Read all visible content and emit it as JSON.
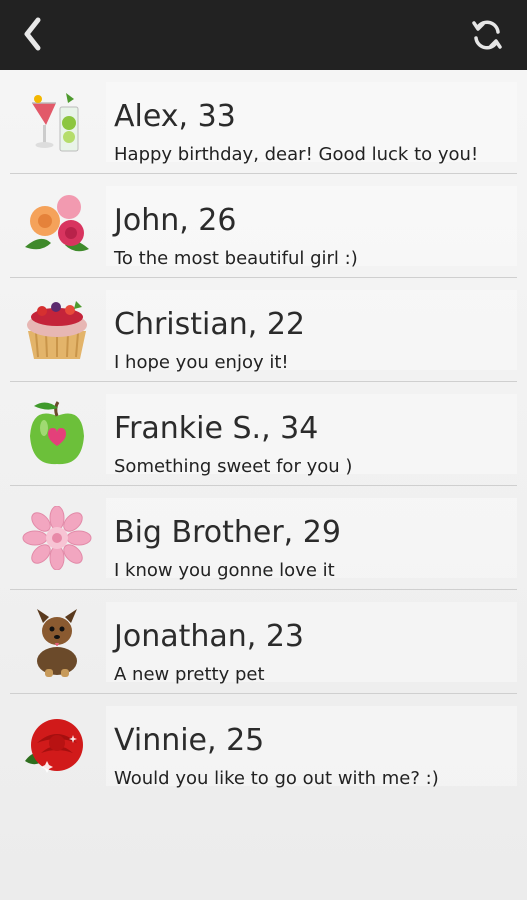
{
  "header": {
    "back_icon": "chevron-left-icon",
    "refresh_icon": "refresh-icon"
  },
  "colors": {
    "topbar": "#222222",
    "background": "#f2f2f2",
    "divider": "#cfcfcf"
  },
  "messages": [
    {
      "name": "Alex, 33",
      "message": "Happy birthday, dear! Good luck to you!",
      "icon": "cocktail-icon"
    },
    {
      "name": "John, 26",
      "message": "To the most beautiful girl :)",
      "icon": "roses-bouquet-icon"
    },
    {
      "name": "Christian, 22",
      "message": "I hope you enjoy it!",
      "icon": "cupcake-icon"
    },
    {
      "name": "Frankie S., 34",
      "message": "Something sweet for you )",
      "icon": "apple-heart-icon"
    },
    {
      "name": "Big Brother, 29",
      "message": "I know you gonne love it",
      "icon": "pink-flower-icon"
    },
    {
      "name": "Jonathan, 23",
      "message": "A new pretty pet",
      "icon": "puppy-icon"
    },
    {
      "name": "Vinnie, 25",
      "message": "Would you like to go out with me? :)",
      "icon": "red-rose-icon"
    }
  ]
}
